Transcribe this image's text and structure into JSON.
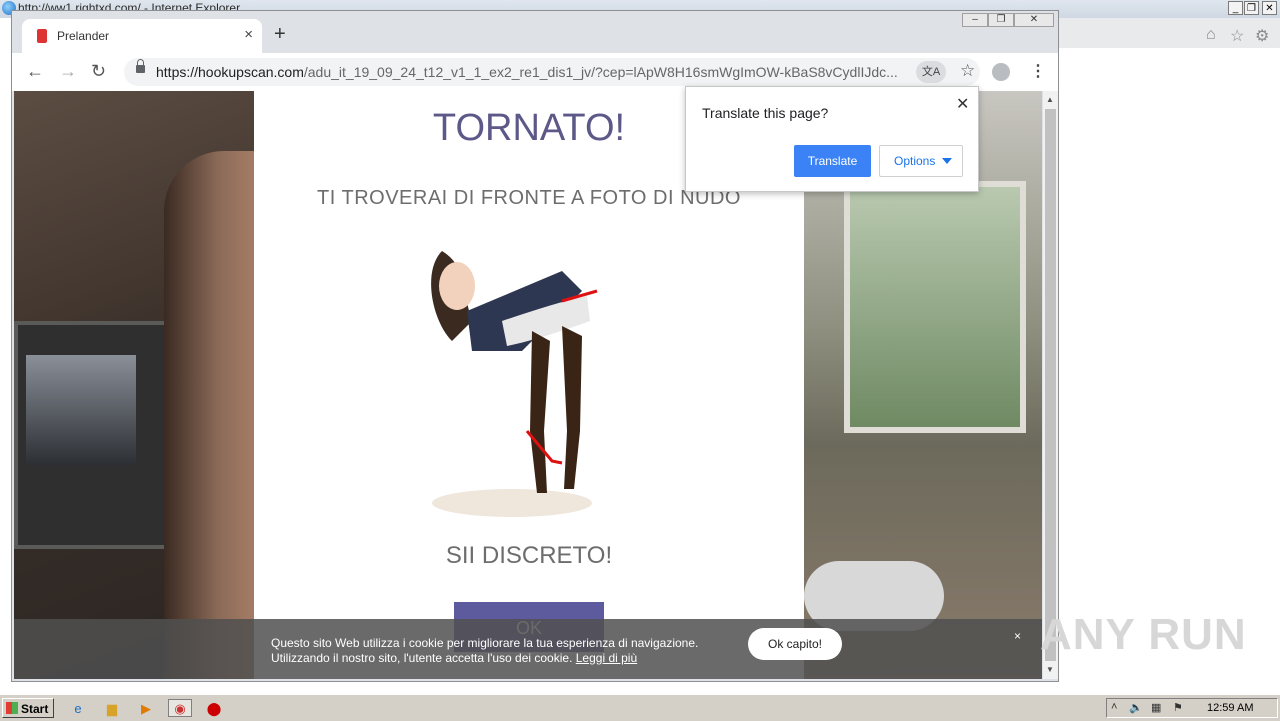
{
  "ie_window": {
    "title": "http://ww1.rightxd.com/ - Internet Explorer"
  },
  "chrome": {
    "tab": {
      "title": "Prelander"
    },
    "address": {
      "host": "https://hookupscan.com",
      "path": "/adu_it_19_09_24_t12_v1_1_ex2_re1_dis1_jv/?cep=lApW8H16smWgImOW-kBaS8vCydlIJdc..."
    }
  },
  "page": {
    "headline": "TORNATO!",
    "subheadline": "TI TROVERAI DI FRONTE A FOTO DI NUDO",
    "discrete": "SII DISCRETO!",
    "ok_label": "OK"
  },
  "cookie_bar": {
    "line1": "Questo sito Web utilizza i cookie per migliorare la tua esperienza di navigazione.",
    "line2": "Utilizzando il nostro sito, l'utente accetta l'uso dei cookie.",
    "link": "Leggi di più",
    "ok_label": "Ok capito!",
    "close": "×"
  },
  "translate_popup": {
    "title": "Translate this page?",
    "translate_label": "Translate",
    "options_label": "Options"
  },
  "watermark": "ANY RUN",
  "taskbar": {
    "start_label": "Start",
    "clock": "12:59 AM"
  }
}
